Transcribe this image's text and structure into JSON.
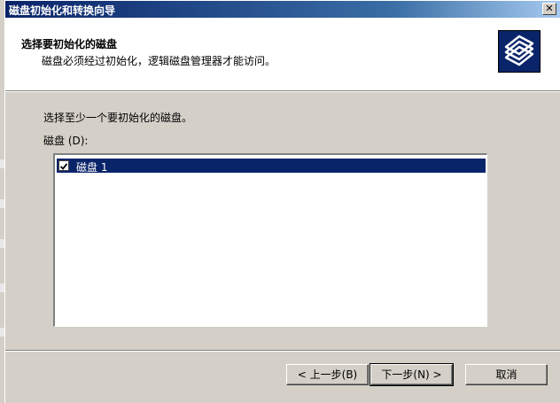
{
  "window": {
    "title": "磁盘初始化和转换向导",
    "close_glyph": "✕"
  },
  "header": {
    "title": "选择要初始化的磁盘",
    "subtitle": "磁盘必须经过初始化，逻辑磁盘管理器才能访问。",
    "icon": "wizard-disks-icon"
  },
  "body": {
    "instruction": "选择至少一个要初始化的磁盘。",
    "list_label": "磁盘 (D):"
  },
  "disk_list": {
    "items": [
      {
        "label": "磁盘 1",
        "checked": true,
        "selected": true
      }
    ]
  },
  "buttons": {
    "back": "< 上一步(B)",
    "next": "下一步(N) >",
    "cancel": "取消"
  },
  "colors": {
    "titlebar_start": "#0a246a",
    "titlebar_end": "#a6caf0",
    "dialog_face": "#d4d0c8",
    "selection": "#0a246a"
  }
}
